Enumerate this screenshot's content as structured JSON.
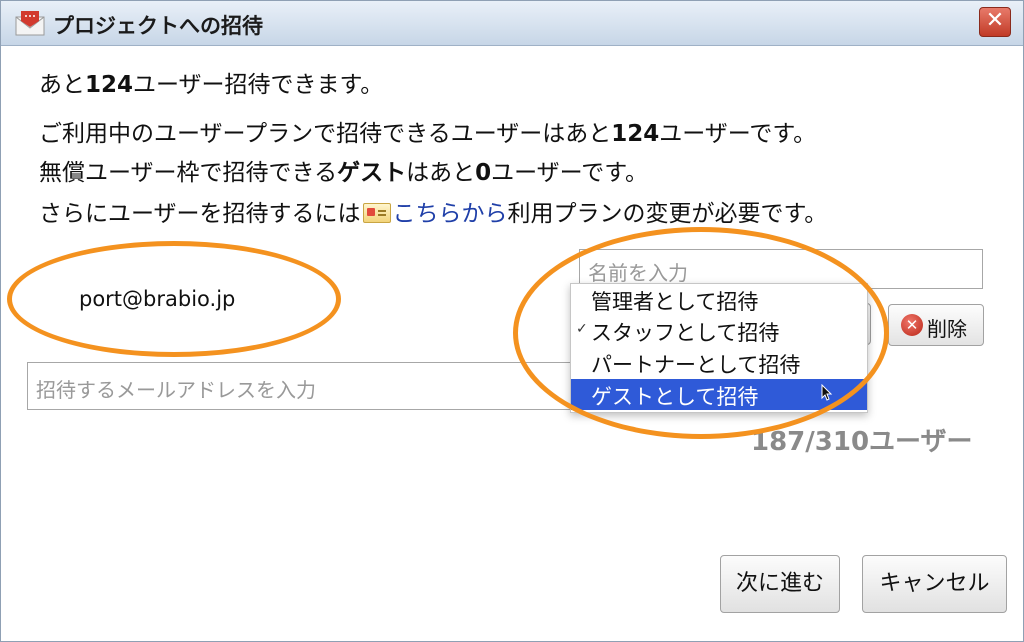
{
  "dialog": {
    "title": "プロジェクトへの招待",
    "close_label": "✕"
  },
  "messages": {
    "line1_a": "あと",
    "line1_b": "124",
    "line1_c": "ユーザー招待できます。",
    "line2_a": "ご利用中のユーザープランで招待できるユーザーはあと",
    "line2_b": "124",
    "line2_c": "ユーザーです。",
    "line3_a": "無償ユーザー枠で招待できる",
    "line3_b": "ゲスト",
    "line3_c": "はあと",
    "line3_d": "0",
    "line3_e": "ユーザーです。",
    "line4_a": "さらにユーザーを招待するには",
    "line4_link": "こちらから",
    "line4_b": "利用プランの変更が必要です。"
  },
  "invite": {
    "email_value": "port@brabio.jp",
    "name_placeholder": "名前を入力",
    "email_placeholder": "招待するメールアドレスを入力",
    "delete_label": "削除"
  },
  "role_menu": {
    "options": [
      "管理者として招待",
      "スタッフとして招待",
      "パートナーとして招待",
      "ゲストとして招待"
    ],
    "checked_index": 1,
    "highlighted_index": 3,
    "check_mark": "✓"
  },
  "usage": {
    "count": "187/310ユーザー"
  },
  "footer": {
    "next_label": "次に進む",
    "cancel_label": "キャンセル"
  },
  "colors": {
    "annotation": "#f4921f",
    "highlight": "#2f5ad8",
    "link": "#1f3fa8"
  }
}
